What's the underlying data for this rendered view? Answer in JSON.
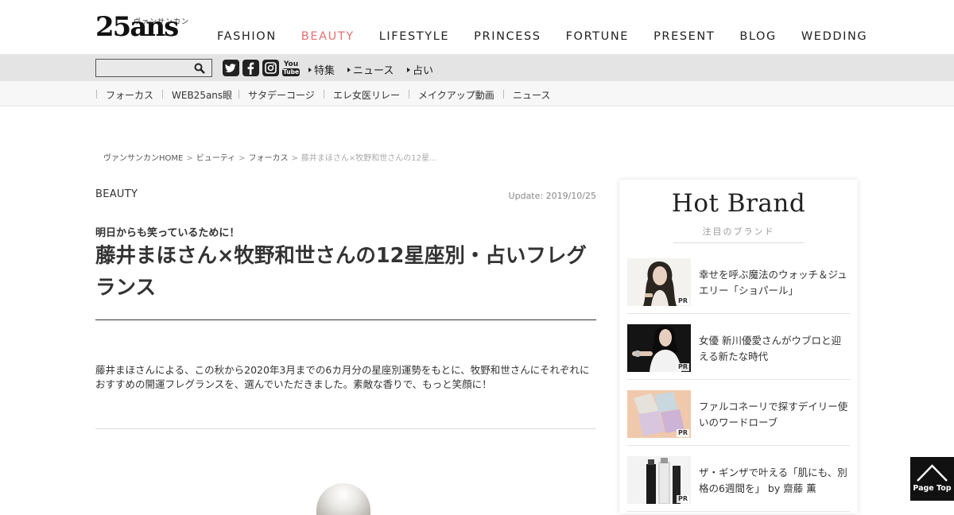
{
  "site": {
    "logo": "25ans",
    "logo_kana": "ヴァンサンカン"
  },
  "main_nav": [
    {
      "label": "FASHION"
    },
    {
      "label": "BEAUTY",
      "active": true
    },
    {
      "label": "LIFESTYLE"
    },
    {
      "label": "PRINCESS"
    },
    {
      "label": "FORTUNE"
    },
    {
      "label": "PRESENT"
    },
    {
      "label": "BLOG"
    },
    {
      "label": "WEDDING"
    }
  ],
  "search": {
    "placeholder": ""
  },
  "social_icons": [
    "twitter-icon",
    "facebook-icon",
    "instagram-icon",
    "youtube-icon"
  ],
  "youtube_text": {
    "you": "You",
    "tube": "Tube"
  },
  "sub_nav": [
    {
      "label": "特集"
    },
    {
      "label": "ニュース"
    },
    {
      "label": "占い"
    }
  ],
  "category_nav": [
    {
      "label": "フォーカス"
    },
    {
      "label": "WEB25ans眼"
    },
    {
      "label": "サタデーコージ"
    },
    {
      "label": "エレ女医リレー"
    },
    {
      "label": "メイクアップ動画"
    },
    {
      "label": "ニュース"
    }
  ],
  "breadcrumb": {
    "items": [
      "ヴァンサンカンHOME",
      "ビューティ",
      "フォーカス"
    ],
    "current": "藤井まほさん×牧野和世さんの12星...",
    "separator": ">"
  },
  "article": {
    "category": "BEAUTY",
    "update": "Update: 2019/10/25",
    "subtitle": "明日からも笑っているために！",
    "title": "藤井まほさん×牧野和世さんの12星座別・占いフレグランス",
    "lead": "藤井まほさんによる、この秋から2020年3月までの6カ月分の星座別運勢をもとに、牧野和世さんにそれぞれにおすすめの開運フレグランスを、選んでいただきました。素敵な香りで、もっと笑顔に！"
  },
  "hot_brand": {
    "title": "Hot Brand",
    "subtitle": "注目のブランド",
    "items": [
      {
        "text": "幸せを呼ぶ魔法のウォッチ＆ジュエリー「ショパール」",
        "badge": "PR"
      },
      {
        "text": "女優 新川優愛さんがウブロと迎える新たな時代",
        "badge": "PR"
      },
      {
        "text": "ファルコネーリで探すデイリー使いのワードローブ",
        "badge": "PR"
      },
      {
        "text": "ザ・ギンザで叶える「肌にも、別格の6週間を」 by 齋藤 薫",
        "badge": "PR"
      }
    ]
  },
  "page_top": {
    "label": "Page Top"
  },
  "colors": {
    "accent": "#e4706f",
    "greybar": "#e4e4e4",
    "catbar": "#f7f7f7",
    "text": "#333333"
  }
}
